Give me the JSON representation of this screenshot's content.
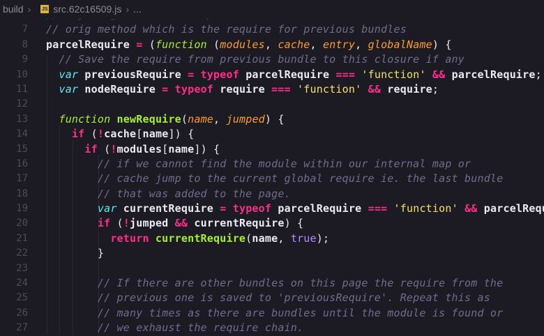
{
  "breadcrumb": {
    "folder": "build",
    "file_icon_text": "JS",
    "file": "src.62c16509.js",
    "trailing": "..."
  },
  "lines": [
    {
      "n": "",
      "segments": [
        {
          "c": "cm",
          "t": "// anything defined in a previous bundle is accessed via the"
        }
      ],
      "dim": true
    },
    {
      "n": "7",
      "segments": [
        {
          "c": "cm",
          "t": "// orig method which is the require for previous bundles"
        }
      ]
    },
    {
      "n": "8",
      "segments": [
        {
          "c": "id b",
          "t": "parcelRequire "
        },
        {
          "c": "kw",
          "t": "="
        },
        {
          "c": "id",
          "t": " ("
        },
        {
          "c": "fn",
          "t": "function"
        },
        {
          "c": "id",
          "t": " ("
        },
        {
          "c": "param",
          "t": "modules"
        },
        {
          "c": "id",
          "t": ", "
        },
        {
          "c": "param",
          "t": "cache"
        },
        {
          "c": "id",
          "t": ", "
        },
        {
          "c": "param",
          "t": "entry"
        },
        {
          "c": "id",
          "t": ", "
        },
        {
          "c": "param",
          "t": "globalName"
        },
        {
          "c": "id",
          "t": ") {"
        }
      ]
    },
    {
      "n": "9",
      "segments": [
        {
          "c": "id",
          "t": "  "
        },
        {
          "c": "cm",
          "t": "// Save the require from previous bundle to this closure if any"
        }
      ]
    },
    {
      "n": "10",
      "segments": [
        {
          "c": "id",
          "t": "  "
        },
        {
          "c": "var",
          "t": "var"
        },
        {
          "c": "id b",
          "t": " previousRequire "
        },
        {
          "c": "kw",
          "t": "="
        },
        {
          "c": "id",
          "t": " "
        },
        {
          "c": "kw",
          "t": "typeof"
        },
        {
          "c": "id b",
          "t": " parcelRequire "
        },
        {
          "c": "kw",
          "t": "==="
        },
        {
          "c": "id",
          "t": " "
        },
        {
          "c": "str",
          "t": "'function'"
        },
        {
          "c": "id",
          "t": " "
        },
        {
          "c": "kw",
          "t": "&&"
        },
        {
          "c": "id b",
          "t": " parcelRequire"
        },
        {
          "c": "id",
          "t": ";"
        }
      ]
    },
    {
      "n": "11",
      "segments": [
        {
          "c": "id",
          "t": "  "
        },
        {
          "c": "var",
          "t": "var"
        },
        {
          "c": "id b",
          "t": " nodeRequire "
        },
        {
          "c": "kw",
          "t": "="
        },
        {
          "c": "id",
          "t": " "
        },
        {
          "c": "kw",
          "t": "typeof"
        },
        {
          "c": "id b",
          "t": " require "
        },
        {
          "c": "kw",
          "t": "==="
        },
        {
          "c": "id",
          "t": " "
        },
        {
          "c": "str",
          "t": "'function'"
        },
        {
          "c": "id",
          "t": " "
        },
        {
          "c": "kw",
          "t": "&&"
        },
        {
          "c": "id b",
          "t": " require"
        },
        {
          "c": "id",
          "t": ";"
        }
      ]
    },
    {
      "n": "12",
      "segments": []
    },
    {
      "n": "13",
      "segments": [
        {
          "c": "id",
          "t": "  "
        },
        {
          "c": "fn",
          "t": "function"
        },
        {
          "c": "call b",
          "t": " newRequire"
        },
        {
          "c": "id",
          "t": "("
        },
        {
          "c": "param",
          "t": "name"
        },
        {
          "c": "id",
          "t": ", "
        },
        {
          "c": "param",
          "t": "jumped"
        },
        {
          "c": "id",
          "t": ") {"
        }
      ]
    },
    {
      "n": "14",
      "segments": [
        {
          "c": "id",
          "t": "    "
        },
        {
          "c": "kw",
          "t": "if"
        },
        {
          "c": "id",
          "t": " ("
        },
        {
          "c": "kw",
          "t": "!"
        },
        {
          "c": "id b",
          "t": "cache"
        },
        {
          "c": "id",
          "t": "["
        },
        {
          "c": "id b",
          "t": "name"
        },
        {
          "c": "id",
          "t": "]) {"
        }
      ]
    },
    {
      "n": "15",
      "segments": [
        {
          "c": "id",
          "t": "      "
        },
        {
          "c": "kw",
          "t": "if"
        },
        {
          "c": "id",
          "t": " ("
        },
        {
          "c": "kw",
          "t": "!"
        },
        {
          "c": "id b",
          "t": "modules"
        },
        {
          "c": "id",
          "t": "["
        },
        {
          "c": "id b",
          "t": "name"
        },
        {
          "c": "id",
          "t": "]) {"
        }
      ]
    },
    {
      "n": "16",
      "segments": [
        {
          "c": "id",
          "t": "        "
        },
        {
          "c": "cm",
          "t": "// if we cannot find the module within our internal map or"
        }
      ]
    },
    {
      "n": "17",
      "segments": [
        {
          "c": "id",
          "t": "        "
        },
        {
          "c": "cm",
          "t": "// cache jump to the current global require ie. the last bundle"
        }
      ]
    },
    {
      "n": "18",
      "segments": [
        {
          "c": "id",
          "t": "        "
        },
        {
          "c": "cm",
          "t": "// that was added to the page."
        }
      ]
    },
    {
      "n": "19",
      "segments": [
        {
          "c": "id",
          "t": "        "
        },
        {
          "c": "var",
          "t": "var"
        },
        {
          "c": "id b",
          "t": " currentRequire "
        },
        {
          "c": "kw",
          "t": "="
        },
        {
          "c": "id",
          "t": " "
        },
        {
          "c": "kw",
          "t": "typeof"
        },
        {
          "c": "id b",
          "t": " parcelRequire "
        },
        {
          "c": "kw",
          "t": "==="
        },
        {
          "c": "id",
          "t": " "
        },
        {
          "c": "str",
          "t": "'function'"
        },
        {
          "c": "id",
          "t": " "
        },
        {
          "c": "kw",
          "t": "&&"
        },
        {
          "c": "id b",
          "t": " parcelRequire"
        },
        {
          "c": "id",
          "t": ";"
        }
      ]
    },
    {
      "n": "20",
      "segments": [
        {
          "c": "id",
          "t": "        "
        },
        {
          "c": "kw",
          "t": "if"
        },
        {
          "c": "id",
          "t": " ("
        },
        {
          "c": "kw",
          "t": "!"
        },
        {
          "c": "id b",
          "t": "jumped "
        },
        {
          "c": "kw",
          "t": "&&"
        },
        {
          "c": "id b",
          "t": " currentRequire"
        },
        {
          "c": "id",
          "t": ") {"
        }
      ]
    },
    {
      "n": "21",
      "segments": [
        {
          "c": "id",
          "t": "          "
        },
        {
          "c": "kw",
          "t": "return"
        },
        {
          "c": "call b",
          "t": " currentRequire"
        },
        {
          "c": "id",
          "t": "("
        },
        {
          "c": "id b",
          "t": "name"
        },
        {
          "c": "id",
          "t": ", "
        },
        {
          "c": "bool",
          "t": "true"
        },
        {
          "c": "id",
          "t": ");"
        }
      ]
    },
    {
      "n": "22",
      "segments": [
        {
          "c": "id",
          "t": "        }"
        }
      ]
    },
    {
      "n": "23",
      "segments": []
    },
    {
      "n": "24",
      "segments": [
        {
          "c": "id",
          "t": "        "
        },
        {
          "c": "cm",
          "t": "// If there are other bundles on this page the require from the"
        }
      ]
    },
    {
      "n": "25",
      "segments": [
        {
          "c": "id",
          "t": "        "
        },
        {
          "c": "cm",
          "t": "// previous one is saved to 'previousRequire'. Repeat this as"
        }
      ]
    },
    {
      "n": "26",
      "segments": [
        {
          "c": "id",
          "t": "        "
        },
        {
          "c": "cm",
          "t": "// many times as there are bundles until the module is found or"
        }
      ]
    },
    {
      "n": "27",
      "segments": [
        {
          "c": "id",
          "t": "        "
        },
        {
          "c": "cm",
          "t": "// we exhaust the require chain."
        }
      ]
    }
  ]
}
